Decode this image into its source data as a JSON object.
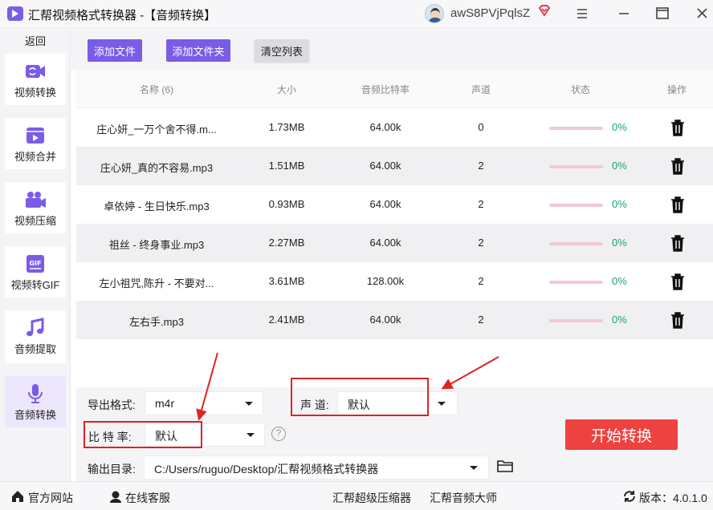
{
  "window": {
    "title": "汇帮视频格式转换器  -【音频转换】",
    "user_name": "awS8PVjPqlsZ"
  },
  "sidebar": {
    "back": "返回",
    "items": [
      {
        "label": "视频转换",
        "icon": "video-convert-icon"
      },
      {
        "label": "视频合并",
        "icon": "video-merge-icon"
      },
      {
        "label": "视频压缩",
        "icon": "video-compress-icon"
      },
      {
        "label": "视频转GIF",
        "icon": "gif-icon"
      },
      {
        "label": "音频提取",
        "icon": "music-note-icon"
      },
      {
        "label": "音频转换",
        "icon": "microphone-icon",
        "active": true
      }
    ]
  },
  "toolbar": {
    "add_file": "添加文件",
    "add_folder": "添加文件夹",
    "clear_list": "清空列表"
  },
  "table": {
    "headers": {
      "name": "名称 (6)",
      "size": "大小",
      "bitrate": "音频比特率",
      "channel": "声道",
      "status": "状态",
      "op": "操作"
    },
    "rows": [
      {
        "name": "庄心妍_一万个舍不得.m...",
        "size": "1.73MB",
        "bitrate": "64.00k",
        "channel": "0",
        "progress": "0%"
      },
      {
        "name": "庄心妍_真的不容易.mp3",
        "size": "1.51MB",
        "bitrate": "64.00k",
        "channel": "2",
        "progress": "0%"
      },
      {
        "name": "卓依婷 - 生日快乐.mp3",
        "size": "0.93MB",
        "bitrate": "64.00k",
        "channel": "2",
        "progress": "0%"
      },
      {
        "name": "祖丝 - 终身事业.mp3",
        "size": "2.27MB",
        "bitrate": "64.00k",
        "channel": "2",
        "progress": "0%"
      },
      {
        "name": "左小祖咒,陈升 - 不要对...",
        "size": "3.61MB",
        "bitrate": "128.00k",
        "channel": "2",
        "progress": "0%"
      },
      {
        "name": "左右手.mp3",
        "size": "2.41MB",
        "bitrate": "64.00k",
        "channel": "2",
        "progress": "0%"
      }
    ]
  },
  "settings": {
    "format_label": "导出格式:",
    "format_value": "m4r",
    "channel_label": "声 道:",
    "channel_value": "默认",
    "bitrate_label": "比 特 率:",
    "bitrate_value": "默认",
    "output_label": "输出目录:",
    "output_value": "C:/Users/ruguo/Desktop/汇帮视频格式转换器",
    "start": "开始转换"
  },
  "statusbar": {
    "website": "官方网站",
    "service": "在线客服",
    "compressor": "汇帮超级压缩器",
    "audio_master": "汇帮音频大师",
    "version": "版本：4.0.1.0"
  },
  "colors": {
    "accent": "#7b5ce6",
    "start": "#ed4240",
    "progress_text": "#19a56b",
    "annotation": "#e02222"
  }
}
